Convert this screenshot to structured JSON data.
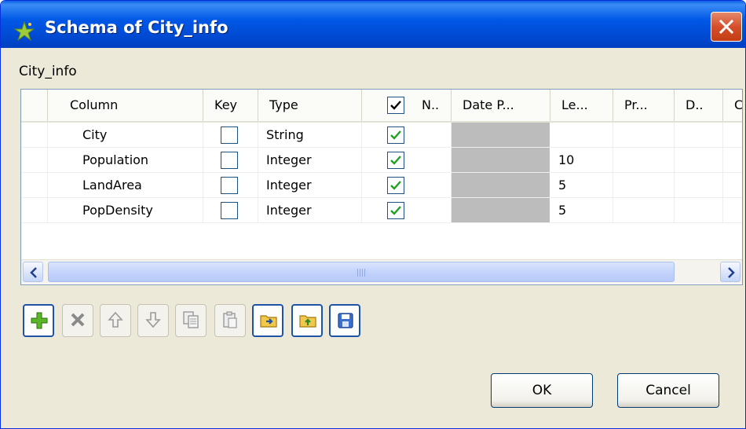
{
  "window": {
    "title": "Schema of City_info"
  },
  "schema_name": "City_info",
  "table": {
    "headers": [
      "Column",
      "Key",
      "Type",
      "N..",
      "Date P...",
      "Le...",
      "Pr...",
      "D..",
      "C"
    ],
    "rows": [
      {
        "column": "City",
        "key": false,
        "type": "String",
        "nullable": true,
        "date_pattern": "",
        "length": "",
        "precision": "",
        "default": ""
      },
      {
        "column": "Population",
        "key": false,
        "type": "Integer",
        "nullable": true,
        "date_pattern": "",
        "length": "10",
        "precision": "",
        "default": ""
      },
      {
        "column": "LandArea",
        "key": false,
        "type": "Integer",
        "nullable": true,
        "date_pattern": "",
        "length": "5",
        "precision": "",
        "default": ""
      },
      {
        "column": "PopDensity",
        "key": false,
        "type": "Integer",
        "nullable": true,
        "date_pattern": "",
        "length": "5",
        "precision": "",
        "default": ""
      }
    ]
  },
  "toolbar": {
    "buttons": [
      {
        "icon": "add-icon",
        "enabled": true
      },
      {
        "icon": "delete-icon",
        "enabled": false
      },
      {
        "icon": "move-up-icon",
        "enabled": false
      },
      {
        "icon": "move-down-icon",
        "enabled": false
      },
      {
        "icon": "copy-icon",
        "enabled": false
      },
      {
        "icon": "paste-icon",
        "enabled": false
      },
      {
        "icon": "import-icon",
        "enabled": true
      },
      {
        "icon": "export-icon",
        "enabled": true
      },
      {
        "icon": "save-icon",
        "enabled": true
      }
    ]
  },
  "buttons": {
    "ok": "OK",
    "cancel": "Cancel"
  },
  "colors": {
    "titlebar": "#0058e6",
    "dialog_bg": "#ece9d8",
    "check_green": "#21a121",
    "grid_gray": "#bcbcbc"
  }
}
